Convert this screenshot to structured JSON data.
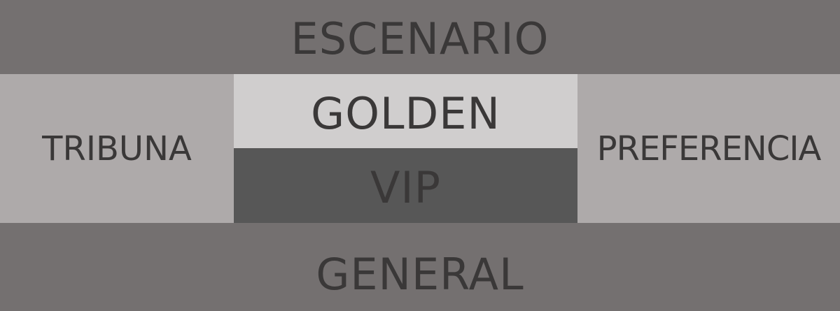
{
  "zones": {
    "escenario": {
      "label": "ESCENARIO",
      "color": "#747070"
    },
    "tribuna": {
      "label": "TRIBUNA",
      "color": "#aeaaaa"
    },
    "golden": {
      "label": "GOLDEN",
      "color": "#d0cece"
    },
    "vip": {
      "label": "VIP",
      "color": "#575757"
    },
    "preferencia": {
      "label": "PREFERENCIA",
      "color": "#aeaaaa"
    },
    "general": {
      "label": "GENERAL",
      "color": "#747070"
    }
  },
  "text_color": "#3a3838"
}
